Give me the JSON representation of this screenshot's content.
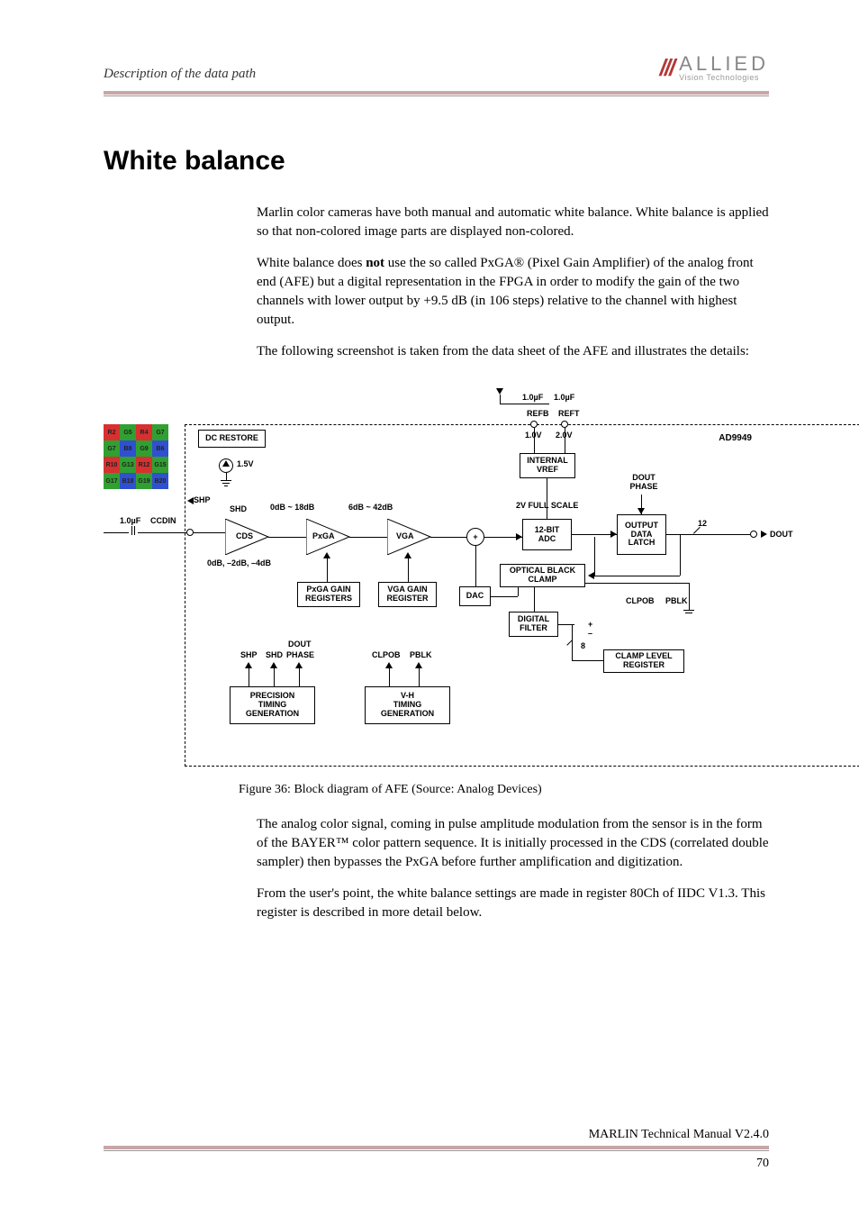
{
  "header": {
    "breadcrumb": "Description of the data path",
    "logo_main": "ALLIED",
    "logo_sub": "Vision Technologies"
  },
  "section": {
    "title": "White balance",
    "p1": "Marlin color cameras have both manual and automatic white balance. White balance is applied so that non-colored image parts are displayed non-colored.",
    "p2_a": "White balance does ",
    "p2_bold": "not",
    "p2_b": " use the so called PxGA® (Pixel Gain Amplifier) of the analog front end (AFE) but a digital representation in the FPGA in order to modify the gain of the two channels with lower output by +9.5 dB (in 106 steps) relative to the channel with highest output.",
    "p3": "The following screenshot is taken from the data sheet of the AFE and illustrates the details:",
    "p4": "The analog color signal, coming in pulse amplitude modulation from the sensor is in the form of the BAYER™ color pattern sequence. It is initially processed in the CDS (correlated double sampler) then bypasses the PxGA before further amplification and digitization.",
    "p5": "From the user's point, the white balance settings are made in register 80Ch of IIDC V1.3. This register is described in more detail below."
  },
  "figure": {
    "caption": "Figure 36: Block diagram of AFE (Source: Analog Devices)"
  },
  "diagram": {
    "part": "AD9949",
    "dc_restore": "DC RESTORE",
    "v15": "1.5V",
    "shp": "SHP",
    "shd": "SHD",
    "ccdin": "CCDIN",
    "cap1": "1.0µF",
    "cds": "CDS",
    "pxga": "PxGA",
    "vga": "VGA",
    "gain1": "0dB ~ 18dB",
    "gain2": "6dB ~ 42dB",
    "gain3": "0dB, –2dB, –4dB",
    "pxga_reg": "PxGA GAIN\nREGISTERS",
    "vga_reg": "VGA GAIN\nREGISTER",
    "dout": "DOUT",
    "shp2": "SHP",
    "shd2": "SHD",
    "phase": "PHASE",
    "clpob": "CLPOB",
    "pblk": "PBLK",
    "precision": "PRECISION\nTIMING\nGENERATION",
    "vh": "V-H\nTIMING\nGENERATION",
    "dac": "DAC",
    "optical": "OPTICAL BLACK\nCLAMP",
    "digital_filter": "DIGITAL\nFILTER",
    "clamp_reg": "CLAMP LEVEL\nREGISTER",
    "adc": "12-BIT\nADC",
    "fullscale": "2V FULL SCALE",
    "vref": "INTERNAL\nVREF",
    "v10": "1.0V",
    "v20": "2.0V",
    "refb": "REFB",
    "reft": "REFT",
    "cap2": "1.0µF",
    "cap3": "1.0µF",
    "latch": "OUTPUT\nDATA\nLATCH",
    "bits12": "12",
    "dout_phase": "DOUT\nPHASE",
    "dout2": "DOUT",
    "clpob2": "CLPOB",
    "pblk2": "PBLK",
    "eight": "8"
  },
  "footer": {
    "manual": "MARLIN Technical Manual V2.4.0",
    "page": "70"
  }
}
